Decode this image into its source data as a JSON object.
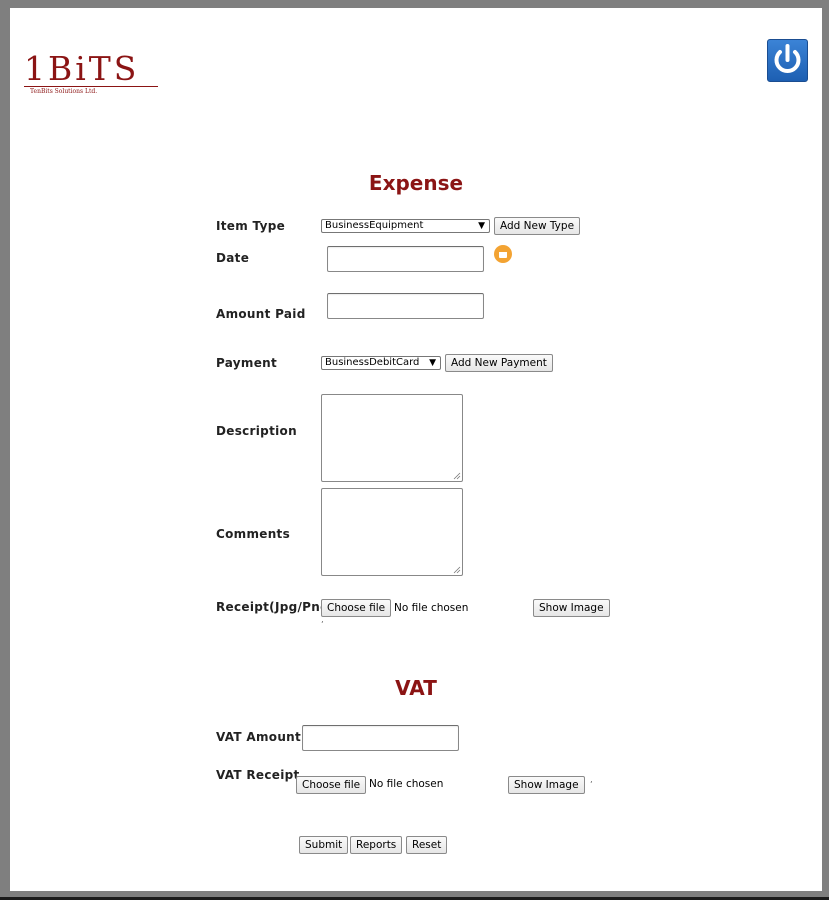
{
  "logo": {
    "text": "1BiTS",
    "subtext": "TenBits Solutions Ltd."
  },
  "header": {
    "power_icon": "power-icon"
  },
  "expense": {
    "title": "Expense",
    "item_type": {
      "label": "Item Type",
      "selected": "BusinessEquipment",
      "add_button": "Add New Type"
    },
    "date": {
      "label": "Date",
      "value": "",
      "icon": "calendar-icon"
    },
    "amount_paid": {
      "label": "Amount Paid",
      "value": ""
    },
    "payment": {
      "label": "Payment",
      "selected": "BusinessDebitCard",
      "add_button": "Add New Payment"
    },
    "description": {
      "label": "Description",
      "value": ""
    },
    "comments": {
      "label": "Comments",
      "value": ""
    },
    "receipt": {
      "label": "Receipt(Jpg/Png)",
      "choose_button": "Choose file",
      "status": "No file chosen",
      "show_button": "Show Image"
    }
  },
  "vat": {
    "title": "VAT",
    "amount": {
      "label": "VAT Amount",
      "value": ""
    },
    "receipt": {
      "label": "VAT Receipt",
      "choose_button": "Choose file",
      "status": "No file chosen",
      "show_button": "Show Image"
    }
  },
  "actions": {
    "submit": "Submit",
    "reports": "Reports",
    "reset": "Reset"
  },
  "colors": {
    "accent": "#8b1414",
    "background": "#7f7f7f",
    "power_button": "#2a6fc4",
    "calendar_icon": "#f3a332"
  }
}
